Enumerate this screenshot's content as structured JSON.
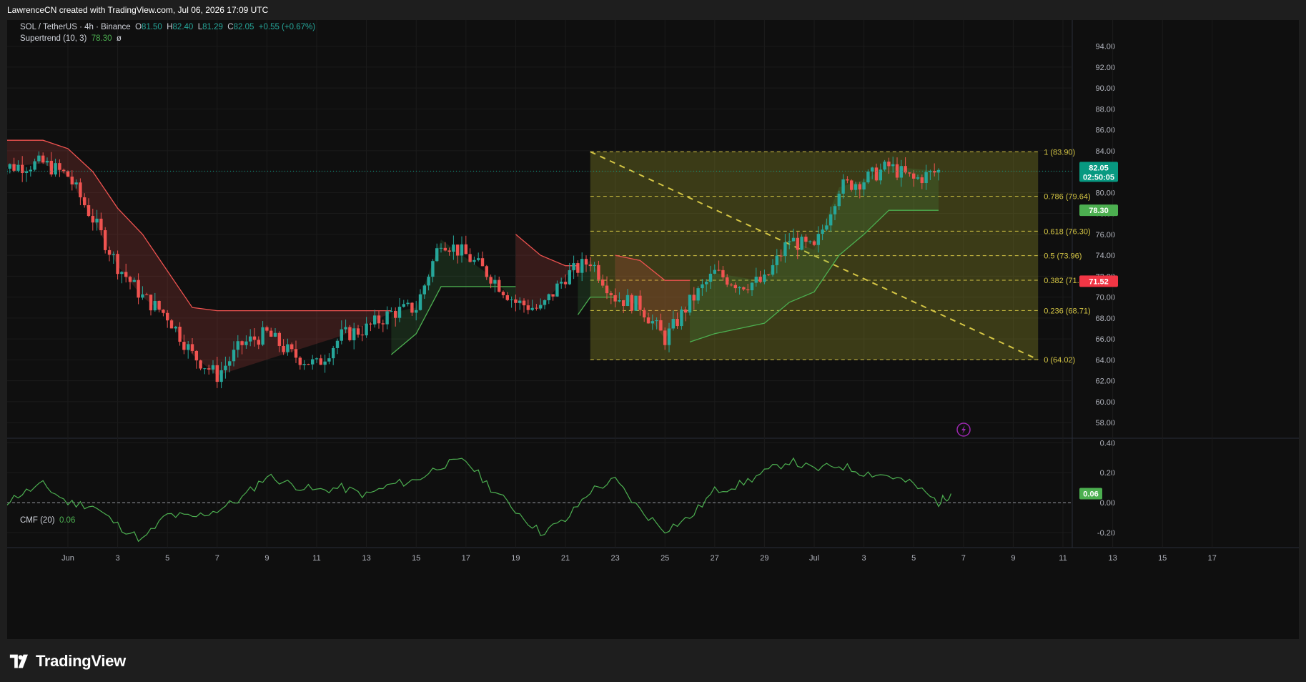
{
  "header": {
    "attribution": "LawrenceCN created with TradingView.com, Jul 06, 2026 17:09 UTC"
  },
  "legend": {
    "symbol": "SOL / TetherUS · 4h · Binance",
    "ohlc_o_label": "O",
    "ohlc_o": "81.50",
    "ohlc_h_label": "H",
    "ohlc_h": "82.40",
    "ohlc_l_label": "L",
    "ohlc_l": "81.29",
    "ohlc_c_label": "C",
    "ohlc_c": "82.05",
    "change": "+0.55 (+0.67%)",
    "supertrend_label": "Supertrend (10, 3)",
    "supertrend_value": "78.30",
    "supertrend_extra": "ø",
    "cmf_label": "CMF (20)",
    "cmf_value": "0.06"
  },
  "price_badges": {
    "last_price": "82.05",
    "countdown": "02:50:05",
    "supertrend": "78.30",
    "red_level": "71.52"
  },
  "brand": {
    "name": "TradingView"
  },
  "colors": {
    "up": "#26a69a",
    "down": "#ef5350",
    "fib": "#d4c544",
    "supertrend_up": "#4caf50",
    "supertrend_down": "#ef5350",
    "cmf_line": "#4caf50",
    "last_price_badge": "#089981",
    "red_badge": "#f23645"
  },
  "icons": {
    "lightning": "lightning-icon",
    "brand_logo": "tradingview-logo-icon"
  },
  "chart_data": [
    {
      "type": "candlestick",
      "title": "SOL / TetherUS · 4h · Binance",
      "y_ticks": [
        "94.00",
        "92.00",
        "90.00",
        "88.00",
        "86.00",
        "84.00",
        "82.00",
        "80.00",
        "78.00",
        "76.00",
        "74.00",
        "72.00",
        "70.00",
        "68.00",
        "66.00",
        "64.00",
        "62.00",
        "60.00",
        "58.00"
      ],
      "ylim": [
        56.5,
        96.5
      ],
      "x_ticks": [
        "Jun",
        "3",
        "5",
        "7",
        "9",
        "11",
        "13",
        "15",
        "17",
        "19",
        "21",
        "23",
        "25",
        "27",
        "29",
        "Jul",
        "3",
        "5",
        "7",
        "9",
        "11",
        "13",
        "15",
        "17"
      ],
      "close_path": {
        "description_points": [
          [
            "2026-05-29",
            82.3
          ],
          [
            "2026-05-31",
            82.8
          ],
          [
            "2026-06-01",
            81.6
          ],
          [
            "2026-06-02",
            77.5
          ],
          [
            "2026-06-03",
            73.0
          ],
          [
            "2026-06-04",
            70.0
          ],
          [
            "2026-06-05",
            68.2
          ],
          [
            "2026-06-06",
            64.5
          ],
          [
            "2026-06-07",
            62.5
          ],
          [
            "2026-06-08",
            65.5
          ],
          [
            "2026-06-09",
            66.5
          ],
          [
            "2026-06-10",
            64.5
          ],
          [
            "2026-06-11",
            63.5
          ],
          [
            "2026-06-12",
            66.3
          ],
          [
            "2026-06-13",
            67.0
          ],
          [
            "2026-06-14",
            68.5
          ],
          [
            "2026-06-15",
            69.0
          ],
          [
            "2026-06-16",
            75.5
          ],
          [
            "2026-06-17",
            74.0
          ],
          [
            "2026-06-18",
            72.0
          ],
          [
            "2026-06-19",
            69.5
          ],
          [
            "2026-06-20",
            68.8
          ],
          [
            "2026-06-21",
            72.0
          ],
          [
            "2026-06-22",
            73.5
          ],
          [
            "2026-06-23",
            70.0
          ],
          [
            "2026-06-24",
            69.2
          ],
          [
            "2026-06-25",
            66.0
          ],
          [
            "2026-06-26",
            69.5
          ],
          [
            "2026-06-27",
            72.3
          ],
          [
            "2026-06-28",
            71.2
          ],
          [
            "2026-06-29",
            71.5
          ],
          [
            "2026-06-30",
            75.5
          ],
          [
            "2026-07-01",
            74.5
          ],
          [
            "2026-07-02",
            80.5
          ],
          [
            "2026-07-03",
            81.2
          ],
          [
            "2026-07-04",
            82.5
          ],
          [
            "2026-07-05",
            81.2
          ],
          [
            "2026-07-06",
            82.05
          ]
        ],
        "last": {
          "open": 81.5,
          "high": 82.4,
          "low": 81.29,
          "close": 82.05
        }
      },
      "supertrend": {
        "value": 78.3,
        "segments": [
          {
            "trend": "down",
            "points": [
              [
                "2026-05-29",
                85.0
              ],
              [
                "2026-05-31",
                85.0
              ],
              [
                "2026-06-01",
                84.2
              ],
              [
                "2026-06-02",
                82.0
              ],
              [
                "2026-06-03",
                78.5
              ],
              [
                "2026-06-04",
                76.0
              ],
              [
                "2026-06-05",
                72.5
              ],
              [
                "2026-06-06",
                69.0
              ],
              [
                "2026-06-07",
                68.7
              ],
              [
                "2026-06-12",
                68.7
              ],
              [
                "2026-06-14",
                68.7
              ]
            ]
          },
          {
            "trend": "up",
            "points": [
              [
                "2026-06-14",
                64.5
              ],
              [
                "2026-06-15",
                66.5
              ],
              [
                "2026-06-16",
                71.0
              ],
              [
                "2026-06-18",
                71.0
              ],
              [
                "2026-06-19",
                71.0
              ]
            ]
          },
          {
            "trend": "down",
            "points": [
              [
                "2026-06-19",
                76.0
              ],
              [
                "2026-06-20",
                74.0
              ],
              [
                "2026-06-21",
                73.0
              ],
              [
                "2026-06-21.5",
                73.0
              ]
            ]
          },
          {
            "trend": "up",
            "points": [
              [
                "2026-06-21.5",
                68.3
              ],
              [
                "2026-06-22",
                70.0
              ],
              [
                "2026-06-23",
                70.0
              ]
            ]
          },
          {
            "trend": "down",
            "points": [
              [
                "2026-06-23",
                74.0
              ],
              [
                "2026-06-24",
                73.5
              ],
              [
                "2026-06-25",
                71.6
              ],
              [
                "2026-06-26",
                71.6
              ]
            ]
          },
          {
            "trend": "up",
            "points": [
              [
                "2026-06-26",
                65.7
              ],
              [
                "2026-06-27",
                66.5
              ],
              [
                "2026-06-29",
                67.5
              ],
              [
                "2026-06-30",
                69.5
              ],
              [
                "2026-07-01",
                70.5
              ],
              [
                "2026-07-02",
                74.0
              ],
              [
                "2026-07-03",
                76.0
              ],
              [
                "2026-07-04",
                78.3
              ],
              [
                "2026-07-06",
                78.3
              ]
            ]
          }
        ]
      },
      "fibonacci": {
        "from": [
          "2026-06-22",
          83.9
        ],
        "to": [
          "2026-07-10",
          64.02
        ],
        "levels": [
          {
            "ratio": 1,
            "label": "1 (83.90)",
            "price": 83.9
          },
          {
            "ratio": 0.786,
            "label": "0.786 (79.64)",
            "price": 79.64
          },
          {
            "ratio": 0.618,
            "label": "0.618 (76.30)",
            "price": 76.3
          },
          {
            "ratio": 0.5,
            "label": "0.5 (73.96)",
            "price": 73.96
          },
          {
            "ratio": 0.382,
            "label": "0.382 (71.61)",
            "price": 71.61
          },
          {
            "ratio": 0.236,
            "label": "0.236 (68.71)",
            "price": 68.71
          },
          {
            "ratio": 0,
            "label": "0 (64.02)",
            "price": 64.02
          }
        ]
      },
      "last_price": 82.05,
      "marked_level": 71.52
    },
    {
      "type": "line",
      "title": "CMF (20)",
      "y_ticks": [
        "0.40",
        "0.20",
        "0.00",
        "-0.20"
      ],
      "ylim": [
        -0.3,
        0.43
      ],
      "value": 0.06,
      "series": [
        {
          "name": "CMF (20)",
          "points": [
            [
              "2026-05-29",
              -0.05
            ],
            [
              "2026-05-30",
              0.05
            ],
            [
              "2026-05-31",
              0.12
            ],
            [
              "2026-06-01",
              0.0
            ],
            [
              "2026-06-02",
              -0.02
            ],
            [
              "2026-06-03",
              -0.15
            ],
            [
              "2026-06-04",
              -0.25
            ],
            [
              "2026-06-05",
              -0.08
            ],
            [
              "2026-06-06",
              -0.1
            ],
            [
              "2026-06-07",
              -0.05
            ],
            [
              "2026-06-08",
              0.03
            ],
            [
              "2026-06-09",
              0.18
            ],
            [
              "2026-06-10",
              0.12
            ],
            [
              "2026-06-11",
              0.08
            ],
            [
              "2026-06-12",
              0.1
            ],
            [
              "2026-06-13",
              0.05
            ],
            [
              "2026-06-14",
              0.12
            ],
            [
              "2026-06-15",
              0.15
            ],
            [
              "2026-06-16",
              0.25
            ],
            [
              "2026-06-17",
              0.28
            ],
            [
              "2026-06-18",
              0.1
            ],
            [
              "2026-06-19",
              -0.05
            ],
            [
              "2026-06-20",
              -0.2
            ],
            [
              "2026-06-21",
              -0.12
            ],
            [
              "2026-06-22",
              0.08
            ],
            [
              "2026-06-23",
              0.15
            ],
            [
              "2026-06-24",
              -0.05
            ],
            [
              "2026-06-25",
              -0.18
            ],
            [
              "2026-06-26",
              -0.1
            ],
            [
              "2026-06-27",
              0.08
            ],
            [
              "2026-06-28",
              0.12
            ],
            [
              "2026-06-29",
              0.2
            ],
            [
              "2026-06-30",
              0.28
            ],
            [
              "2026-07-01",
              0.22
            ],
            [
              "2026-07-02",
              0.25
            ],
            [
              "2026-07-03",
              0.2
            ],
            [
              "2026-07-04",
              0.18
            ],
            [
              "2026-07-05",
              0.12
            ],
            [
              "2026-07-06",
              0.0
            ],
            [
              "2026-07-06.5",
              0.06
            ]
          ]
        }
      ]
    }
  ]
}
